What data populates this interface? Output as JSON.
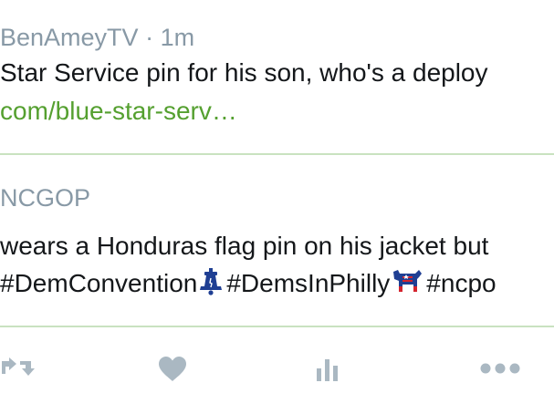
{
  "tweet1": {
    "handle": "BenAmeyTV",
    "separator": " · ",
    "time": "1m",
    "text": "Star Service pin for his son, who's a deploy",
    "link": "com/blue-star-serv…"
  },
  "tweet2": {
    "handle": "NCGOP",
    "text": "wears a Honduras flag pin on his jacket but",
    "hashtags": [
      "#DemConvention",
      "#DemsInPhilly",
      "#ncpo"
    ],
    "emoji": [
      "liberty-bell-icon",
      "democrat-donkey-icon"
    ]
  },
  "actions": [
    "retweet-icon",
    "like-icon",
    "analytics-icon",
    "more-icon"
  ],
  "colors": {
    "meta": "#8899a6",
    "link": "#55a030",
    "divider": "#c9e2c0",
    "icon": "#aab8c2",
    "text": "#14171a"
  }
}
